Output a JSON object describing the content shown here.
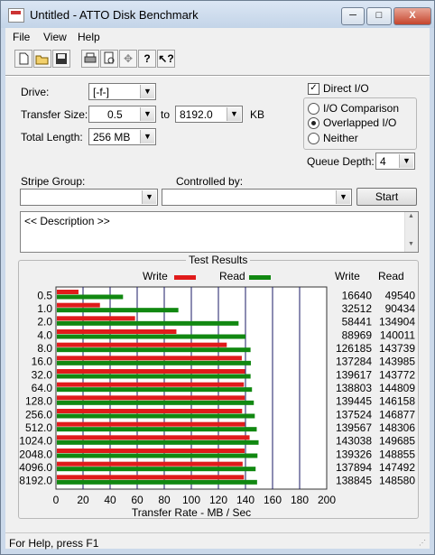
{
  "window": {
    "title": "Untitled - ATTO Disk Benchmark"
  },
  "titlebar_buttons": {
    "minimize": "─",
    "maximize": "□",
    "close": "X"
  },
  "menu": {
    "file": "File",
    "view": "View",
    "help": "Help"
  },
  "toolbar": {
    "icons": [
      "new-icon",
      "open-icon",
      "save-icon",
      "print-icon",
      "print-preview-icon",
      "move-icon",
      "help-icon",
      "context-help-icon"
    ]
  },
  "form": {
    "drive_label": "Drive:",
    "drive_value": "[-f-]",
    "transfer_size_label": "Transfer Size:",
    "transfer_from": "0.5",
    "to_label": "to",
    "transfer_to": "8192.0",
    "kb_label": "KB",
    "total_length_label": "Total Length:",
    "total_length_value": "256 MB",
    "direct_io_label": "Direct I/O",
    "direct_io_checked": true,
    "io_comparison_label": "I/O Comparison",
    "overlapped_io_label": "Overlapped I/O",
    "neither_label": "Neither",
    "selected_mode": "Overlapped I/O",
    "queue_depth_label": "Queue Depth:",
    "queue_depth_value": "4",
    "stripe_group_label": "Stripe Group:",
    "stripe_group_value": "",
    "controlled_by_label": "Controlled by:",
    "controlled_by_value": "",
    "start_button": "Start",
    "description_text": "<< Description >>"
  },
  "results": {
    "title": "Test Results",
    "write_legend": "Write",
    "read_legend": "Read",
    "write_col_header": "Write",
    "read_col_header": "Read",
    "colors": {
      "write": "#e01b1b",
      "read": "#118811",
      "grid": "#1a1a66"
    }
  },
  "chart_data": {
    "type": "bar",
    "orientation": "horizontal",
    "categories": [
      "0.5",
      "1.0",
      "2.0",
      "4.0",
      "8.0",
      "16.0",
      "32.0",
      "64.0",
      "128.0",
      "256.0",
      "512.0",
      "1024.0",
      "2048.0",
      "4096.0",
      "8192.0"
    ],
    "series": [
      {
        "name": "Write",
        "values": [
          16640,
          32512,
          58441,
          88969,
          126185,
          137284,
          139617,
          138803,
          139445,
          137524,
          139567,
          143038,
          139326,
          137894,
          138845
        ]
      },
      {
        "name": "Read",
        "values": [
          49540,
          90434,
          134904,
          140011,
          143739,
          143985,
          143772,
          144809,
          146158,
          146877,
          148306,
          149685,
          148855,
          147492,
          148580
        ]
      }
    ],
    "xlabel": "Transfer Rate - MB / Sec",
    "xlim": [
      0,
      200
    ],
    "xticks": [
      "0",
      "20",
      "40",
      "60",
      "80",
      "100",
      "120",
      "140",
      "160",
      "180",
      "200"
    ],
    "grid": true,
    "legend": "top"
  },
  "status": {
    "text": "For Help, press F1"
  }
}
